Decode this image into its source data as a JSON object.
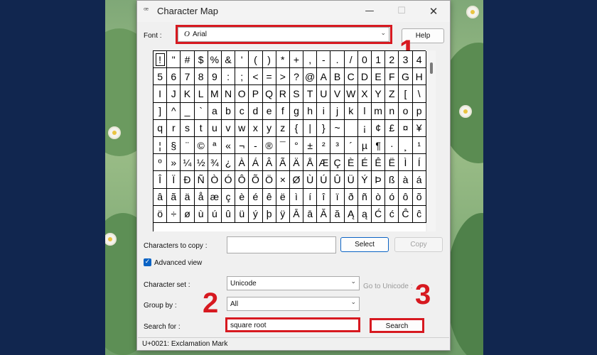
{
  "window": {
    "title": "Character Map",
    "minimize_glyph": "—",
    "maximize_glyph": "☐",
    "close_glyph": "✕"
  },
  "font_row": {
    "label": "Font :",
    "value": "Arial",
    "font_icon_glyph": "O",
    "help_label": "Help"
  },
  "char_rows": [
    [
      "!",
      "\"",
      "#",
      "$",
      "%",
      "&",
      "'",
      "(",
      ")",
      "*",
      "+",
      ",",
      "-",
      ".",
      "/",
      "0",
      "1",
      "2",
      "3",
      "4"
    ],
    [
      "5",
      "6",
      "7",
      "8",
      "9",
      ":",
      ";",
      "<",
      "=",
      ">",
      "?",
      "@",
      "A",
      "B",
      "C",
      "D",
      "E",
      "F",
      "G",
      "H"
    ],
    [
      "I",
      "J",
      "K",
      "L",
      "M",
      "N",
      "O",
      "P",
      "Q",
      "R",
      "S",
      "T",
      "U",
      "V",
      "W",
      "X",
      "Y",
      "Z",
      "[",
      "\\"
    ],
    [
      "]",
      "^",
      "_",
      "`",
      "a",
      "b",
      "c",
      "d",
      "e",
      "f",
      "g",
      "h",
      "i",
      "j",
      "k",
      "l",
      "m",
      "n",
      "o",
      "p"
    ],
    [
      "q",
      "r",
      "s",
      "t",
      "u",
      "v",
      "w",
      "x",
      "y",
      "z",
      "{",
      "|",
      "}",
      "~",
      "",
      "¡",
      "¢",
      "£",
      "¤",
      "¥"
    ],
    [
      "¦",
      "§",
      "¨",
      "©",
      "ª",
      "«",
      "¬",
      "-",
      "®",
      "¯",
      "°",
      "±",
      "²",
      "³",
      "´",
      "µ",
      "¶",
      "·",
      "¸",
      "¹"
    ],
    [
      "º",
      "»",
      "¼",
      "½",
      "¾",
      "¿",
      "À",
      "Á",
      "Â",
      "Ã",
      "Ä",
      "Å",
      "Æ",
      "Ç",
      "È",
      "É",
      "Ê",
      "Ë",
      "Ì",
      "Í"
    ],
    [
      "Î",
      "Ï",
      "Ð",
      "Ñ",
      "Ò",
      "Ó",
      "Ô",
      "Õ",
      "Ö",
      "×",
      "Ø",
      "Ù",
      "Ú",
      "Û",
      "Ü",
      "Ý",
      "Þ",
      "ß",
      "à",
      "á"
    ],
    [
      "â",
      "ã",
      "ä",
      "å",
      "æ",
      "ç",
      "è",
      "é",
      "ê",
      "ë",
      "ì",
      "í",
      "î",
      "ï",
      "ð",
      "ñ",
      "ò",
      "ó",
      "ô",
      "õ"
    ],
    [
      "ö",
      "÷",
      "ø",
      "ù",
      "ú",
      "û",
      "ü",
      "ý",
      "þ",
      "ÿ",
      "Ā",
      "ā",
      "Ă",
      "ă",
      "Ą",
      "ą",
      "Ć",
      "ć",
      "Ĉ",
      "ĉ"
    ]
  ],
  "copy_row": {
    "label": "Characters to copy :",
    "value": "",
    "select_label": "Select",
    "copy_label": "Copy"
  },
  "advanced_view": {
    "label": "Advanced view",
    "checked": true,
    "check_glyph": "✓"
  },
  "character_set": {
    "label": "Character set :",
    "value": "Unicode",
    "goto_label": "Go to Unicode :"
  },
  "group_by": {
    "label": "Group by :",
    "value": "All"
  },
  "search": {
    "label": "Search for :",
    "value": "square root",
    "button_label": "Search"
  },
  "status_bar": {
    "text": "U+0021: Exclamation Mark"
  },
  "annotations": {
    "step1": "1",
    "step2": "2",
    "step3": "3",
    "highlight_color": "#d71920"
  },
  "icons": {
    "dropdown": "chevron-down-icon",
    "app": "character-map-icon",
    "font_type": "opentype-font-icon"
  }
}
